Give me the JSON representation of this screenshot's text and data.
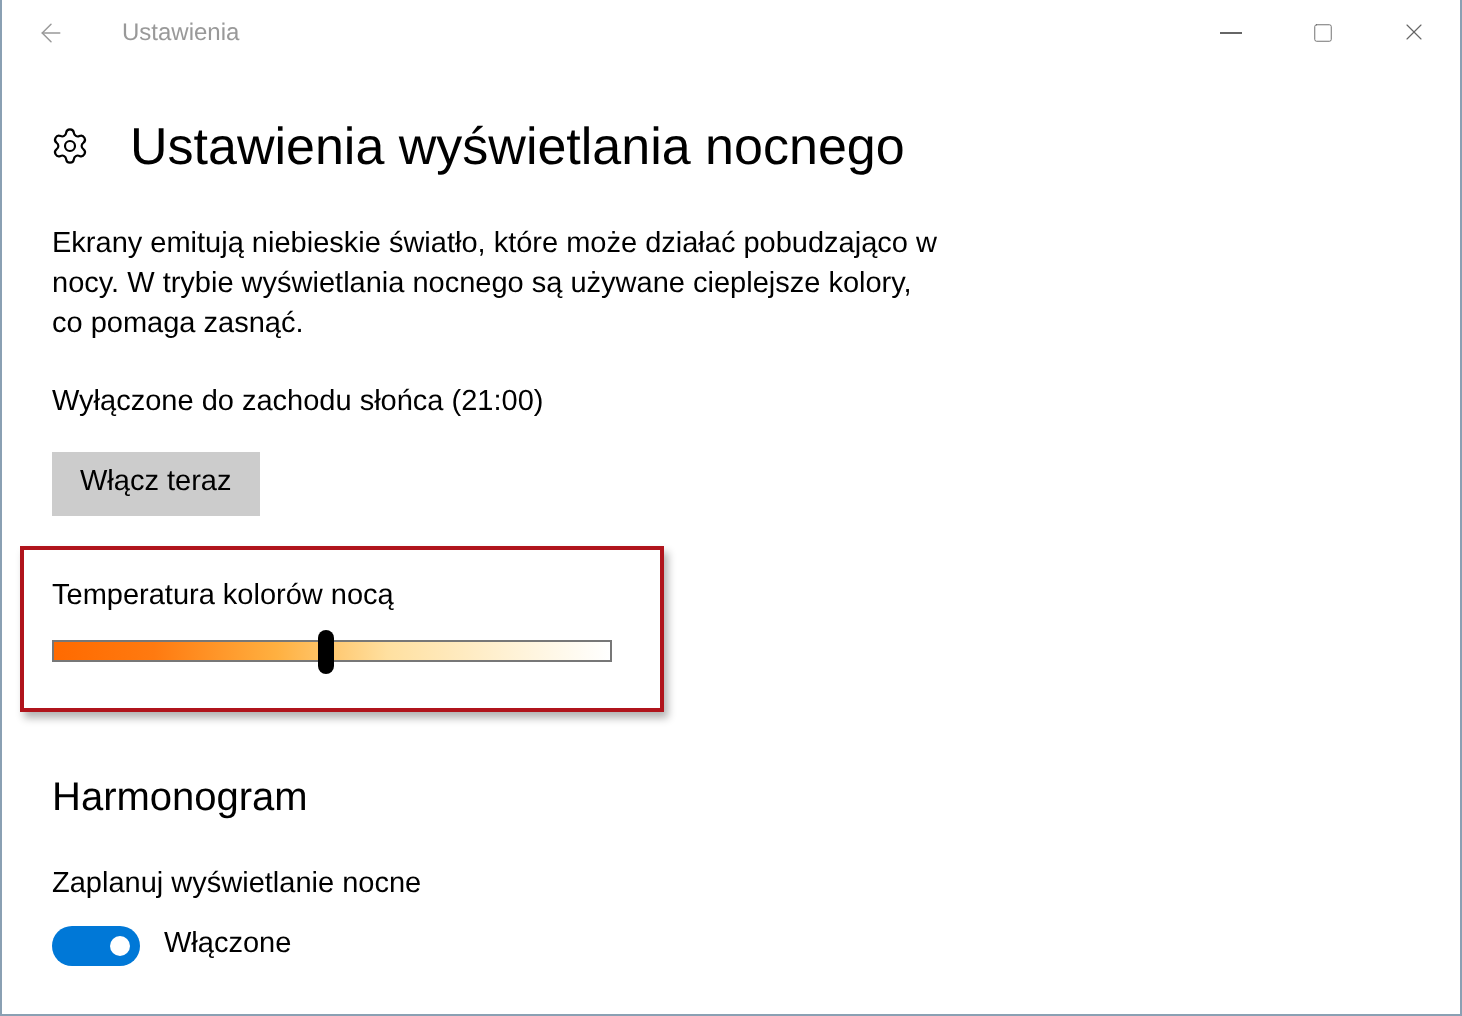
{
  "window": {
    "title": "Ustawienia"
  },
  "page": {
    "title": "Ustawienia wyświetlania nocnego",
    "description": "Ekrany emitują niebieskie światło, które może działać pobudzająco w nocy. W trybie wyświetlania nocnego są używane cieplejsze kolory, co pomaga zasnąć.",
    "status": "Wyłączone do zachodu słońca (21:00)",
    "button": "Włącz teraz"
  },
  "temperature": {
    "label": "Temperatura kolorów nocą",
    "level": 0.49
  },
  "schedule": {
    "heading": "Harmonogram",
    "label": "Zaplanuj wyświetlanie nocne",
    "on": true,
    "state_label": "Włączone"
  }
}
